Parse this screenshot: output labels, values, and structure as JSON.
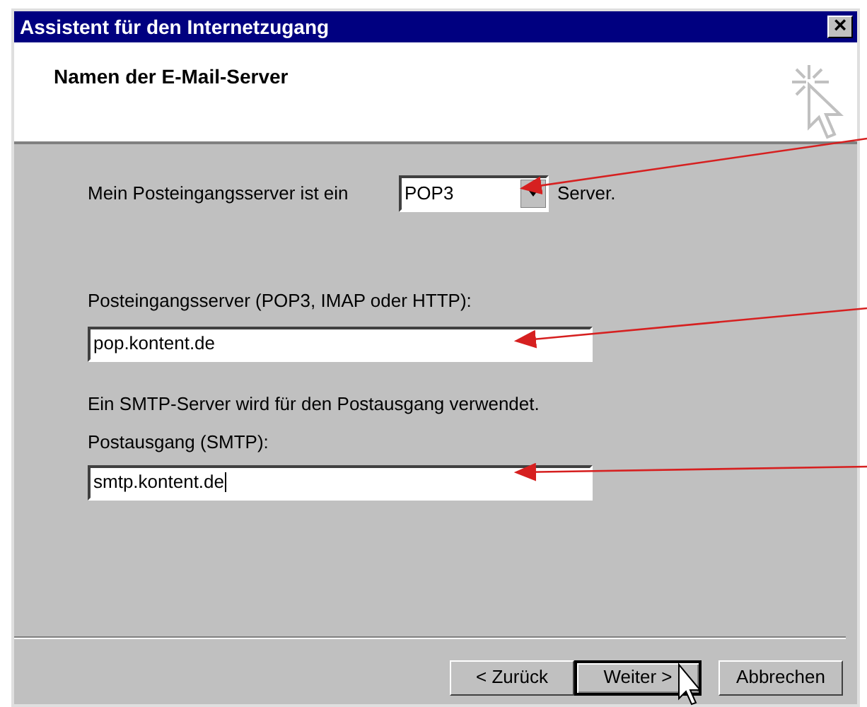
{
  "window": {
    "title": "Assistent für den Internetzugang",
    "close": "×"
  },
  "header": {
    "title": "Namen der E-Mail-Server"
  },
  "incoming_type": {
    "label": "Mein Posteingangsserver ist ein",
    "value": "POP3",
    "suffix": "Server."
  },
  "incoming_server": {
    "label": "Posteingangsserver (POP3, IMAP oder HTTP):",
    "value": "pop.kontent.de"
  },
  "smtp_note": "Ein SMTP-Server wird für den Postausgang verwendet.",
  "outgoing_server": {
    "label": "Postausgang (SMTP):",
    "value": "smtp.kontent.de"
  },
  "buttons": [
    {
      "label": "< Zurück",
      "default": false
    },
    {
      "label": "Weiter >",
      "default": true
    },
    {
      "label": "Abbrechen",
      "default": false
    }
  ]
}
